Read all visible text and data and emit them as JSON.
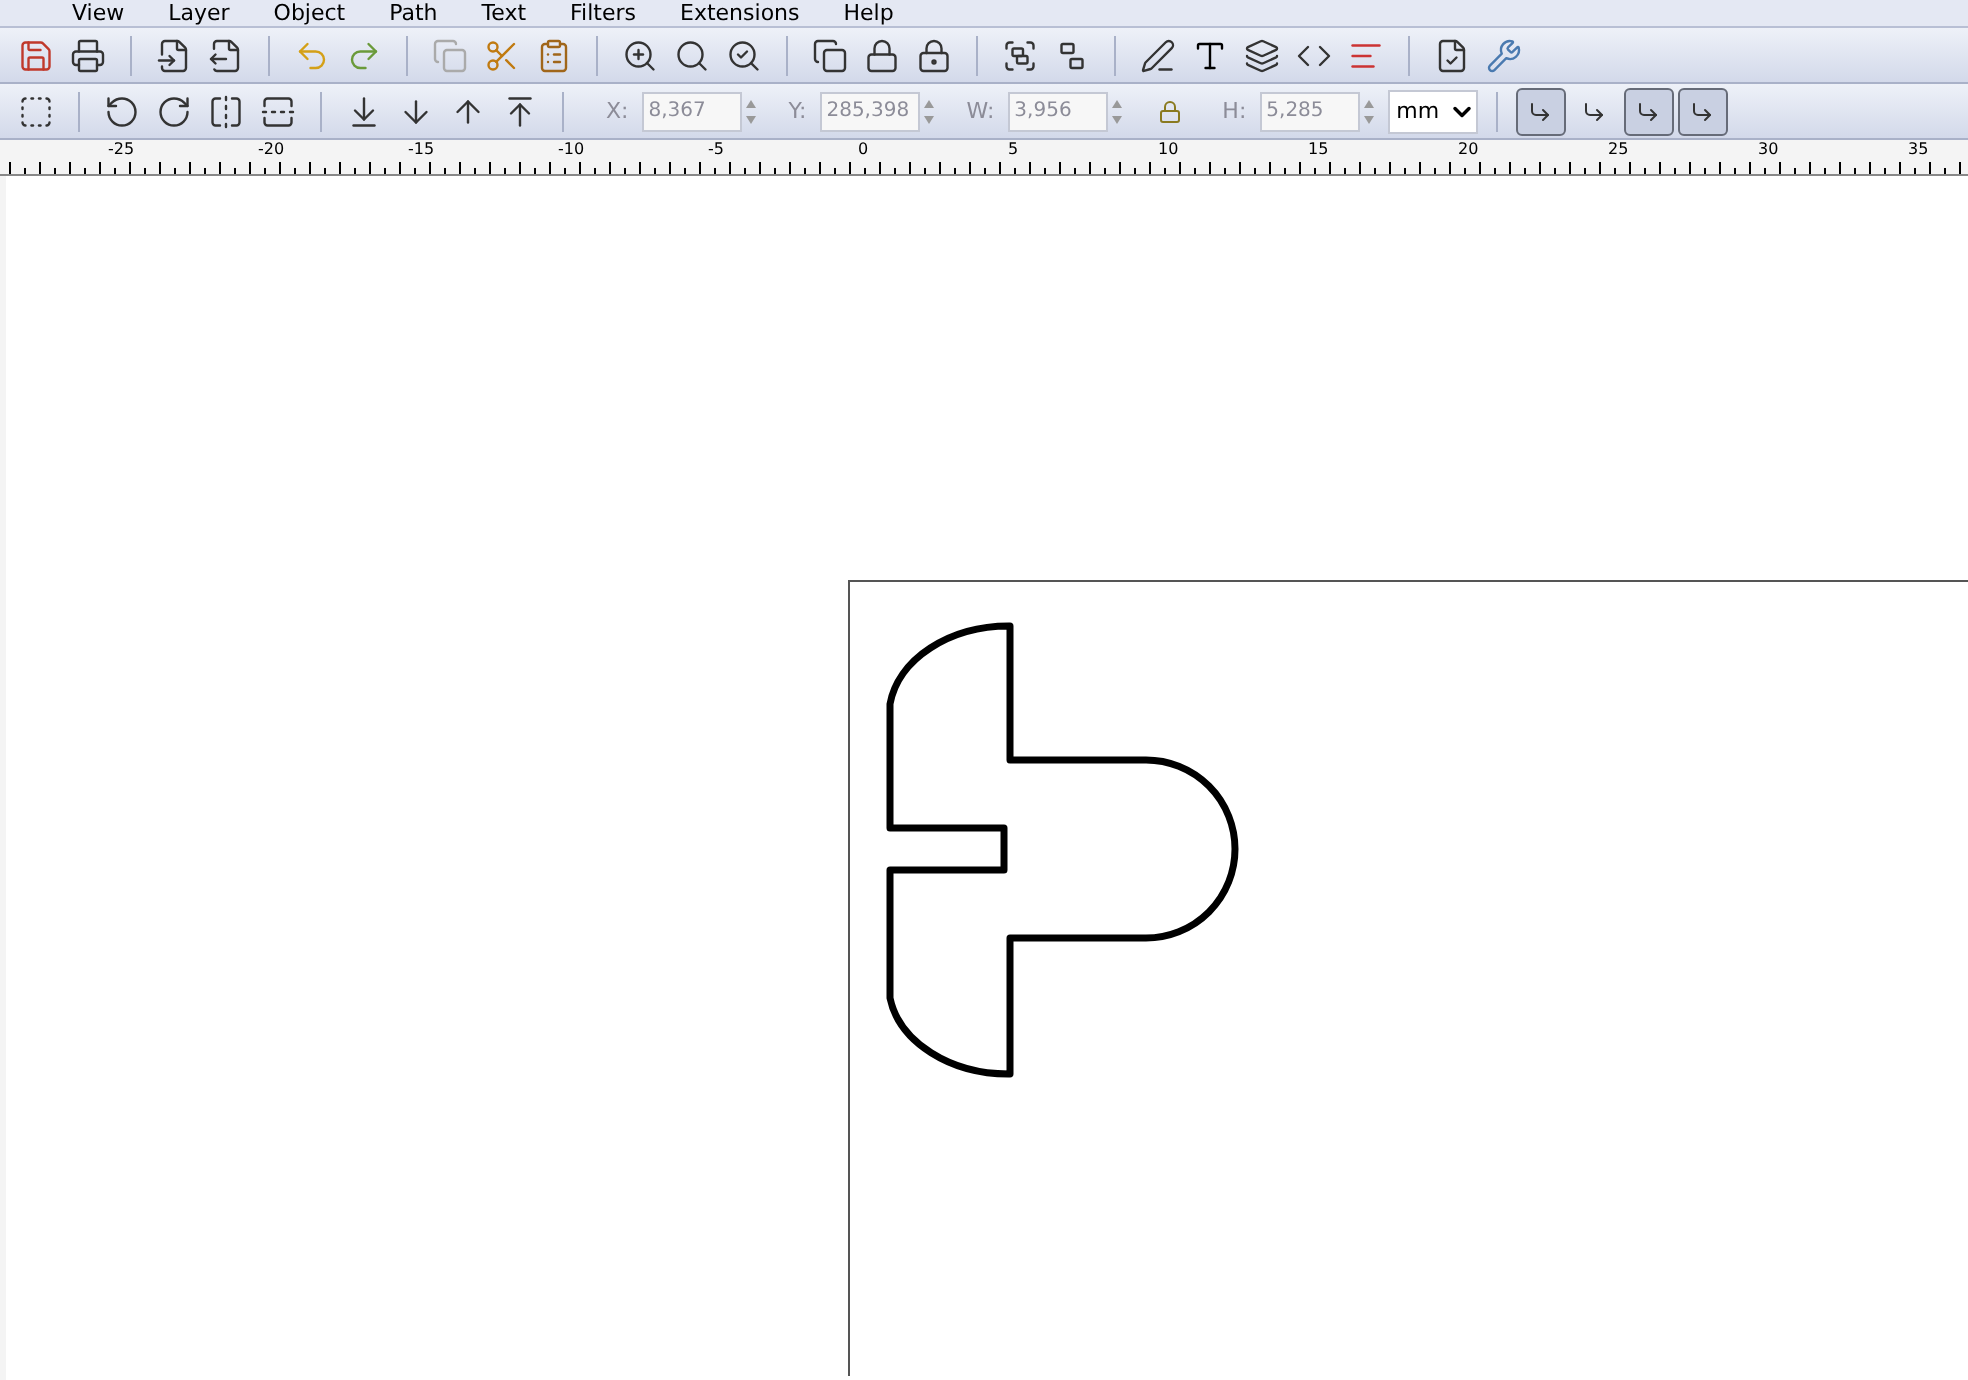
{
  "menu": [
    "View",
    "Layer",
    "Object",
    "Path",
    "Text",
    "Filters",
    "Extensions",
    "Help"
  ],
  "fields": [
    {
      "label": "X:",
      "value": "8,367"
    },
    {
      "label": "Y:",
      "value": "285,398"
    },
    {
      "label": "W:",
      "value": "3,956"
    },
    {
      "label": "H:",
      "value": "5,285"
    }
  ],
  "unit": "mm",
  "toggles": [
    {
      "on": true
    },
    {
      "on": false
    },
    {
      "on": true
    },
    {
      "on": true
    }
  ],
  "ruler": [
    "-25",
    "-20",
    "-15",
    "-10",
    "-5",
    "0",
    "5",
    "10",
    "15",
    "20",
    "25",
    "30",
    "35"
  ]
}
